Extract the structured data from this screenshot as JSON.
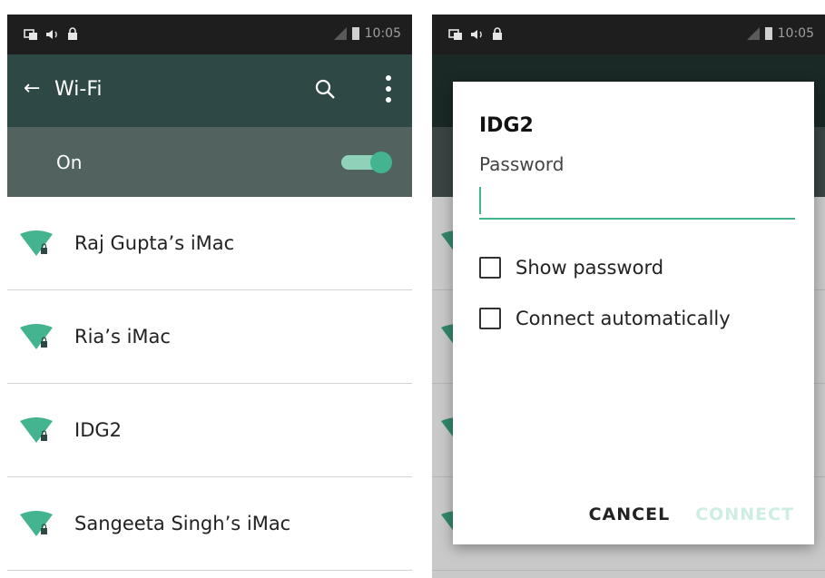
{
  "status_bar": {
    "time": "10:05"
  },
  "left": {
    "appbar": {
      "back_icon": "back-arrow-icon",
      "title": "Wi-Fi",
      "search_icon": "search-icon",
      "more_icon": "more-vert-icon"
    },
    "toggle": {
      "label": "On",
      "state": "on"
    },
    "networks": [
      {
        "name": "Raj Gupta’s iMac",
        "icon": "wifi-locked-icon"
      },
      {
        "name": "Ria’s iMac",
        "icon": "wifi-locked-icon"
      },
      {
        "name": "IDG2",
        "icon": "wifi-locked-icon"
      },
      {
        "name": "Sangeeta Singh’s iMac",
        "icon": "wifi-locked-icon"
      }
    ]
  },
  "dialog": {
    "title": "IDG2",
    "password_label": "Password",
    "password_value": "",
    "show_password": {
      "label": "Show password",
      "checked": false
    },
    "connect_auto": {
      "label": "Connect automatically",
      "checked": false
    },
    "cancel_label": "CANCEL",
    "connect_label": "CONNECT"
  },
  "colors": {
    "accent": "#43b390",
    "appbar": "#2d4845",
    "toggle_bar": "#51625f",
    "status_bar": "#1e1e1e"
  }
}
